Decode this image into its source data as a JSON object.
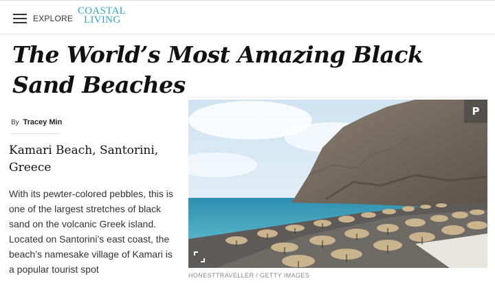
{
  "header": {
    "menu_icon": "hamburger-menu-icon",
    "explore_label": "EXPLORE",
    "logo_line1": "COASTAL",
    "logo_line2": "LIVING",
    "logo_color": "#2fa6c6"
  },
  "article": {
    "headline": "The World’s Most Amazing Black Sand Beaches",
    "byline_prefix": "By",
    "author": "Tracey Min",
    "section_title": "Kamari Beach, Santorini, Greece",
    "body": "With its pewter-colored pebbles, this is one of the largest stretches of black sand on the volcanic Greek island. Located on Santorini’s east coast, the beach’s namesake village of Kamari is a popular tourist spot"
  },
  "photo": {
    "pin_glyph": "P",
    "pin_icon": "pinterest-icon",
    "expand_icon": "expand-icon",
    "credit": "HONESTTRAVELLER / GETTY IMAGES"
  }
}
